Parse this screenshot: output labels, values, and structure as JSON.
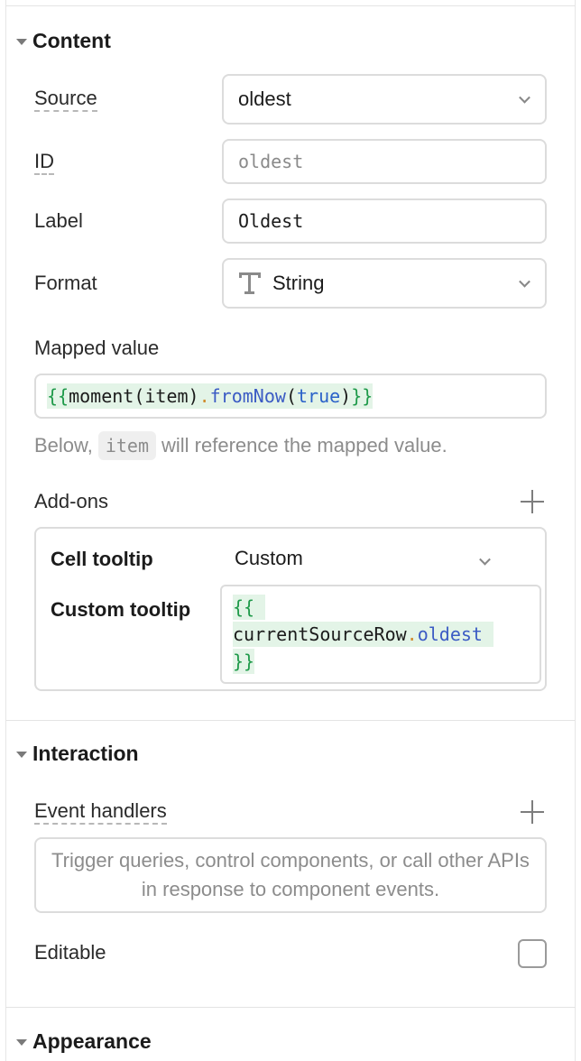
{
  "content": {
    "title": "Content",
    "source": {
      "label": "Source",
      "value": "oldest"
    },
    "id": {
      "label": "ID",
      "placeholder": "oldest"
    },
    "label_field": {
      "label": "Label",
      "value": "Oldest"
    },
    "format": {
      "label": "Format",
      "value": "String",
      "icon": "text-type-icon"
    },
    "mapped_value": {
      "label": "Mapped value",
      "code": {
        "open": "{{",
        "p1": "moment(item)",
        "dot": ".",
        "fn": "fromNow",
        "p2": "(",
        "kw": "true",
        "p3": ")",
        "close": "}}"
      }
    },
    "hint": {
      "before": "Below,",
      "chip": "item",
      "after": "will reference the mapped value."
    },
    "addons": {
      "label": "Add-ons",
      "cell_tooltip": {
        "label": "Cell tooltip",
        "value": "Custom"
      },
      "custom_tooltip": {
        "label": "Custom tooltip",
        "open": "{{",
        "obj": "currentSourceRow",
        "dot": ".",
        "prop": "oldest",
        "close": "}}"
      }
    }
  },
  "interaction": {
    "title": "Interaction",
    "event_handlers": {
      "label": "Event handlers",
      "empty_text": "Trigger queries, control components, or call other APIs in response to component events."
    },
    "editable": {
      "label": "Editable",
      "checked": false
    }
  },
  "appearance": {
    "title": "Appearance"
  }
}
